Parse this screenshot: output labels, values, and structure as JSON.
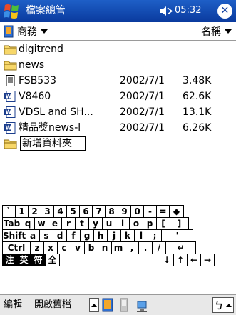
{
  "titlebar": {
    "title": "檔案總管",
    "time": "05:32"
  },
  "folderbar": {
    "folder": "商務",
    "sort": "名稱"
  },
  "files": [
    {
      "name": "digitrend",
      "type": "folder-icon",
      "date": "",
      "size": ""
    },
    {
      "name": "news",
      "type": "folder-icon",
      "date": "",
      "size": ""
    },
    {
      "name": "FSB533",
      "type": "note-icon",
      "date": "2002/7/1",
      "size": "3.48K"
    },
    {
      "name": "V8460",
      "type": "word-doc-icon",
      "date": "2002/7/1",
      "size": "62.6K"
    },
    {
      "name": "VDSL and SH...",
      "type": "word-doc-icon",
      "date": "2002/7/1",
      "size": "13.1K"
    },
    {
      "name": "精品獎news-l",
      "type": "word-doc-icon",
      "date": "2002/7/1",
      "size": "6.26K"
    },
    {
      "name": "新增資料夾",
      "type": "folder-icon",
      "date": "",
      "size": ""
    }
  ],
  "keyboard": {
    "rows": [
      [
        "`",
        "1",
        "2",
        "3",
        "4",
        "5",
        "6",
        "7",
        "8",
        "9",
        "0",
        "-",
        "=",
        "◆"
      ],
      [
        "Tab",
        "q",
        "w",
        "e",
        "r",
        "t",
        "y",
        "u",
        "i",
        "o",
        "p",
        "[",
        "]"
      ],
      [
        "Shift",
        "a",
        "s",
        "d",
        "f",
        "g",
        "h",
        "j",
        "k",
        "l",
        ";",
        "'"
      ],
      [
        "Ctrl",
        "z",
        "x",
        "c",
        "v",
        "b",
        "n",
        "m",
        ",",
        ".",
        "/",
        "↵"
      ],
      [
        "注",
        "英",
        "符",
        "全",
        "↓",
        "↑",
        "←",
        "→"
      ]
    ]
  },
  "menubar": {
    "edit": "編輯",
    "open_menu": "開啟舊檔",
    "sip_label": "ㄅ"
  }
}
